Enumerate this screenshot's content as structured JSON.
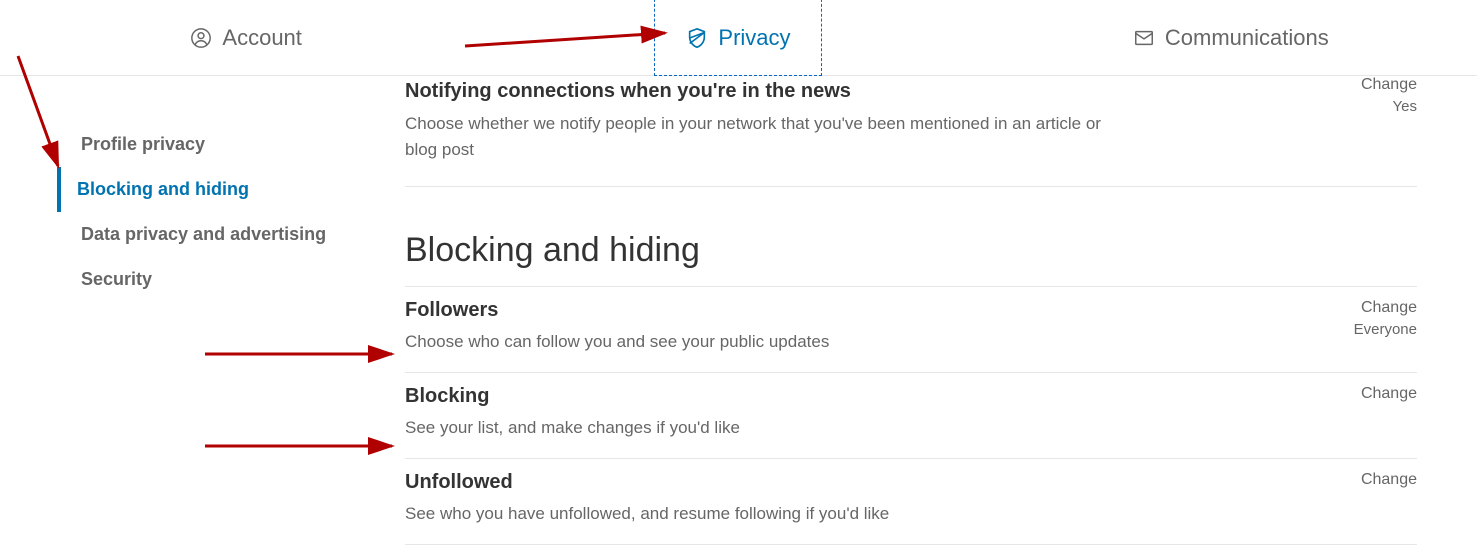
{
  "topnav": {
    "tabs": [
      {
        "label": "Account"
      },
      {
        "label": "Privacy"
      },
      {
        "label": "Communications"
      }
    ]
  },
  "sidebar": {
    "items": [
      {
        "label": "Profile privacy"
      },
      {
        "label": "Blocking and hiding"
      },
      {
        "label": "Data privacy and advertising"
      },
      {
        "label": "Security"
      }
    ]
  },
  "news_section": {
    "title": "Notifying connections when you're in the news",
    "description": "Choose whether we notify people in your network that you've been mentioned in an article or blog post",
    "action": "Change",
    "value": "Yes"
  },
  "section_title": "Blocking and hiding",
  "settings": [
    {
      "title": "Followers",
      "description": "Choose who can follow you and see your public updates",
      "action": "Change",
      "value": "Everyone"
    },
    {
      "title": "Blocking",
      "description": "See your list, and make changes if you'd like",
      "action": "Change",
      "value": ""
    },
    {
      "title": "Unfollowed",
      "description": "See who you have unfollowed, and resume following if you'd like",
      "action": "Change",
      "value": ""
    }
  ]
}
